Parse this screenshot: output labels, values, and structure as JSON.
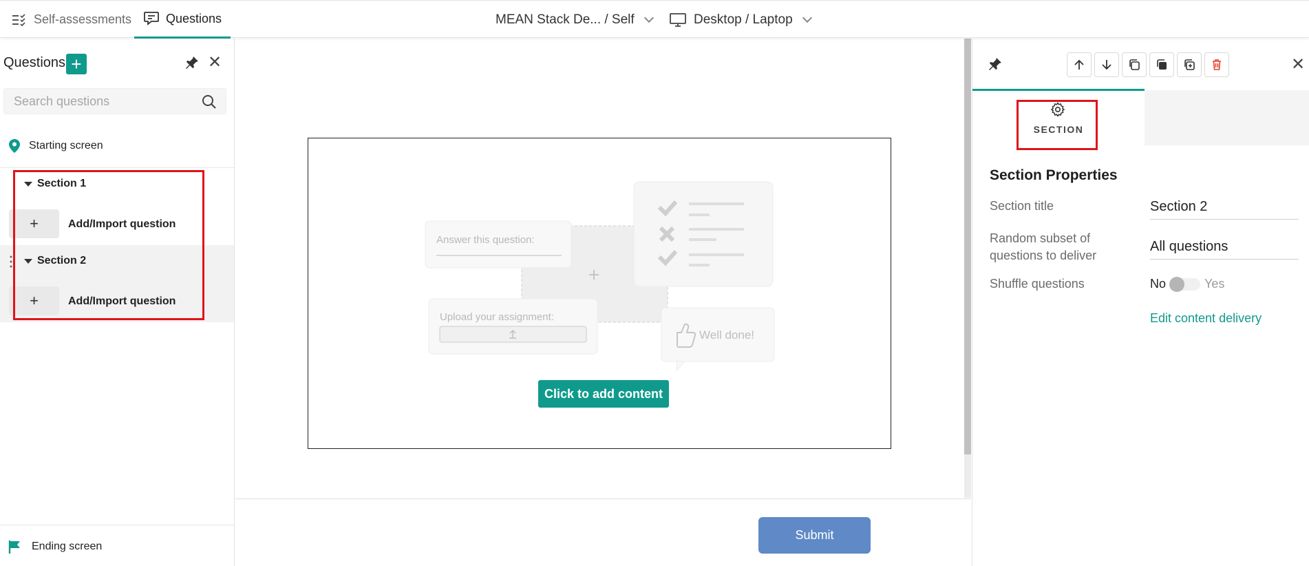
{
  "topbar": {
    "tabs": [
      {
        "label": "Self-assessments",
        "icon": "list-check-icon",
        "active": false
      },
      {
        "label": "Questions",
        "icon": "question-bubble-icon",
        "active": true
      }
    ],
    "assessment_selector": "MEAN Stack De...  / Self",
    "device_selector": "Desktop / Laptop"
  },
  "left_panel": {
    "title": "Questions",
    "search_placeholder": "Search questions",
    "starting_screen": "Starting screen",
    "sections": [
      {
        "label": "Section 1",
        "add_label": "Add/Import question"
      },
      {
        "label": "Section 2",
        "add_label": "Add/Import question"
      }
    ],
    "ending_screen": "Ending screen"
  },
  "canvas": {
    "illustration": {
      "answer_placeholder": "Answer this question:",
      "upload_label": "Upload your assignment:",
      "well_done": "Well done!"
    },
    "cta_label": "Click to add content",
    "submit_label": "Submit"
  },
  "right_panel": {
    "tab_label": "SECTION",
    "heading": "Section Properties",
    "fields": {
      "section_title_label": "Section title",
      "section_title_value": "Section 2",
      "random_subset_label": "Random subset of questions to deliver",
      "random_subset_value": "All questions",
      "shuffle_label": "Shuffle questions",
      "shuffle_no": "No",
      "shuffle_yes": "Yes"
    },
    "edit_link": "Edit content delivery"
  },
  "colors": {
    "accent": "#109a8c",
    "submit": "#5f89c7",
    "highlight": "#e0131a",
    "delete": "#e5412b"
  }
}
